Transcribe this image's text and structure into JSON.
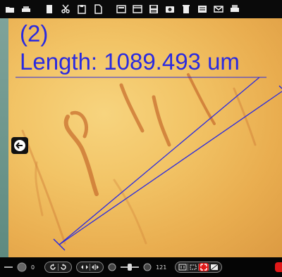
{
  "toolbar": {
    "icons": [
      "open-icon",
      "save-icon",
      "copy-icon",
      "cut-icon",
      "paste-icon",
      "new-icon",
      "layout-icon",
      "window-icon",
      "disk-icon",
      "camera-icon",
      "delete-icon",
      "pdf-icon",
      "email-icon",
      "print-icon"
    ]
  },
  "measurement": {
    "index": "(2)",
    "length_text": "Length: 1089.493 um"
  },
  "bottom": {
    "exposure_value": "0",
    "zoom_value": "121"
  },
  "colors": {
    "annotation": "#2a2ae0",
    "accent_red": "#e01818"
  }
}
